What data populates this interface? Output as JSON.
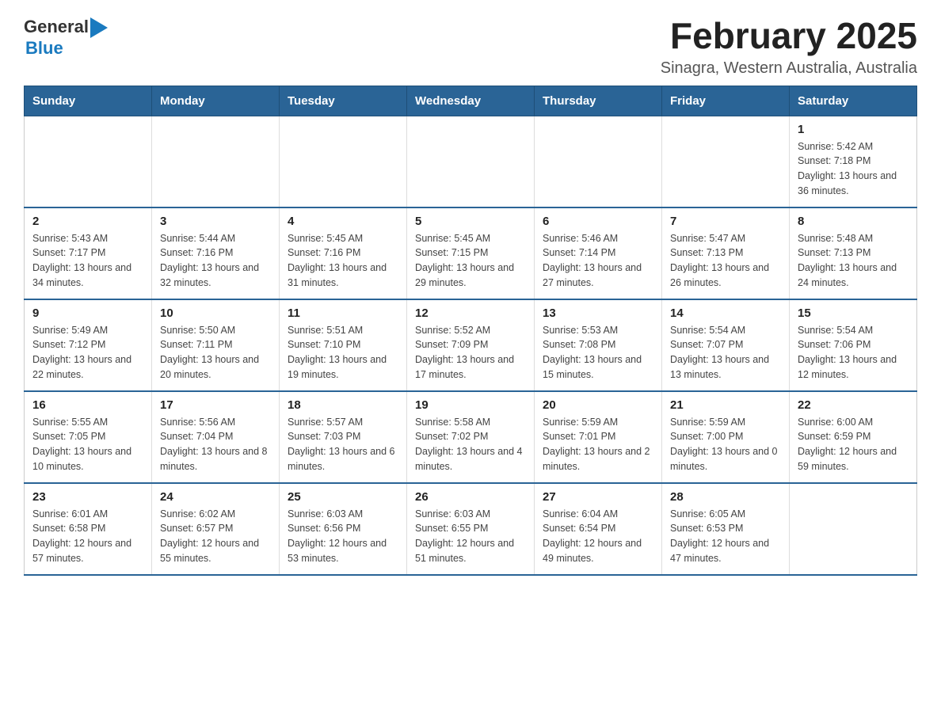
{
  "header": {
    "logo": {
      "text_general": "General",
      "text_blue": "Blue",
      "arrow_color": "#1a7abf"
    },
    "title": "February 2025",
    "subtitle": "Sinagra, Western Australia, Australia"
  },
  "weekdays": [
    "Sunday",
    "Monday",
    "Tuesday",
    "Wednesday",
    "Thursday",
    "Friday",
    "Saturday"
  ],
  "weeks": [
    {
      "days": [
        {
          "number": "",
          "info": ""
        },
        {
          "number": "",
          "info": ""
        },
        {
          "number": "",
          "info": ""
        },
        {
          "number": "",
          "info": ""
        },
        {
          "number": "",
          "info": ""
        },
        {
          "number": "",
          "info": ""
        },
        {
          "number": "1",
          "info": "Sunrise: 5:42 AM\nSunset: 7:18 PM\nDaylight: 13 hours and 36 minutes."
        }
      ]
    },
    {
      "days": [
        {
          "number": "2",
          "info": "Sunrise: 5:43 AM\nSunset: 7:17 PM\nDaylight: 13 hours and 34 minutes."
        },
        {
          "number": "3",
          "info": "Sunrise: 5:44 AM\nSunset: 7:16 PM\nDaylight: 13 hours and 32 minutes."
        },
        {
          "number": "4",
          "info": "Sunrise: 5:45 AM\nSunset: 7:16 PM\nDaylight: 13 hours and 31 minutes."
        },
        {
          "number": "5",
          "info": "Sunrise: 5:45 AM\nSunset: 7:15 PM\nDaylight: 13 hours and 29 minutes."
        },
        {
          "number": "6",
          "info": "Sunrise: 5:46 AM\nSunset: 7:14 PM\nDaylight: 13 hours and 27 minutes."
        },
        {
          "number": "7",
          "info": "Sunrise: 5:47 AM\nSunset: 7:13 PM\nDaylight: 13 hours and 26 minutes."
        },
        {
          "number": "8",
          "info": "Sunrise: 5:48 AM\nSunset: 7:13 PM\nDaylight: 13 hours and 24 minutes."
        }
      ]
    },
    {
      "days": [
        {
          "number": "9",
          "info": "Sunrise: 5:49 AM\nSunset: 7:12 PM\nDaylight: 13 hours and 22 minutes."
        },
        {
          "number": "10",
          "info": "Sunrise: 5:50 AM\nSunset: 7:11 PM\nDaylight: 13 hours and 20 minutes."
        },
        {
          "number": "11",
          "info": "Sunrise: 5:51 AM\nSunset: 7:10 PM\nDaylight: 13 hours and 19 minutes."
        },
        {
          "number": "12",
          "info": "Sunrise: 5:52 AM\nSunset: 7:09 PM\nDaylight: 13 hours and 17 minutes."
        },
        {
          "number": "13",
          "info": "Sunrise: 5:53 AM\nSunset: 7:08 PM\nDaylight: 13 hours and 15 minutes."
        },
        {
          "number": "14",
          "info": "Sunrise: 5:54 AM\nSunset: 7:07 PM\nDaylight: 13 hours and 13 minutes."
        },
        {
          "number": "15",
          "info": "Sunrise: 5:54 AM\nSunset: 7:06 PM\nDaylight: 13 hours and 12 minutes."
        }
      ]
    },
    {
      "days": [
        {
          "number": "16",
          "info": "Sunrise: 5:55 AM\nSunset: 7:05 PM\nDaylight: 13 hours and 10 minutes."
        },
        {
          "number": "17",
          "info": "Sunrise: 5:56 AM\nSunset: 7:04 PM\nDaylight: 13 hours and 8 minutes."
        },
        {
          "number": "18",
          "info": "Sunrise: 5:57 AM\nSunset: 7:03 PM\nDaylight: 13 hours and 6 minutes."
        },
        {
          "number": "19",
          "info": "Sunrise: 5:58 AM\nSunset: 7:02 PM\nDaylight: 13 hours and 4 minutes."
        },
        {
          "number": "20",
          "info": "Sunrise: 5:59 AM\nSunset: 7:01 PM\nDaylight: 13 hours and 2 minutes."
        },
        {
          "number": "21",
          "info": "Sunrise: 5:59 AM\nSunset: 7:00 PM\nDaylight: 13 hours and 0 minutes."
        },
        {
          "number": "22",
          "info": "Sunrise: 6:00 AM\nSunset: 6:59 PM\nDaylight: 12 hours and 59 minutes."
        }
      ]
    },
    {
      "days": [
        {
          "number": "23",
          "info": "Sunrise: 6:01 AM\nSunset: 6:58 PM\nDaylight: 12 hours and 57 minutes."
        },
        {
          "number": "24",
          "info": "Sunrise: 6:02 AM\nSunset: 6:57 PM\nDaylight: 12 hours and 55 minutes."
        },
        {
          "number": "25",
          "info": "Sunrise: 6:03 AM\nSunset: 6:56 PM\nDaylight: 12 hours and 53 minutes."
        },
        {
          "number": "26",
          "info": "Sunrise: 6:03 AM\nSunset: 6:55 PM\nDaylight: 12 hours and 51 minutes."
        },
        {
          "number": "27",
          "info": "Sunrise: 6:04 AM\nSunset: 6:54 PM\nDaylight: 12 hours and 49 minutes."
        },
        {
          "number": "28",
          "info": "Sunrise: 6:05 AM\nSunset: 6:53 PM\nDaylight: 12 hours and 47 minutes."
        },
        {
          "number": "",
          "info": ""
        }
      ]
    }
  ]
}
